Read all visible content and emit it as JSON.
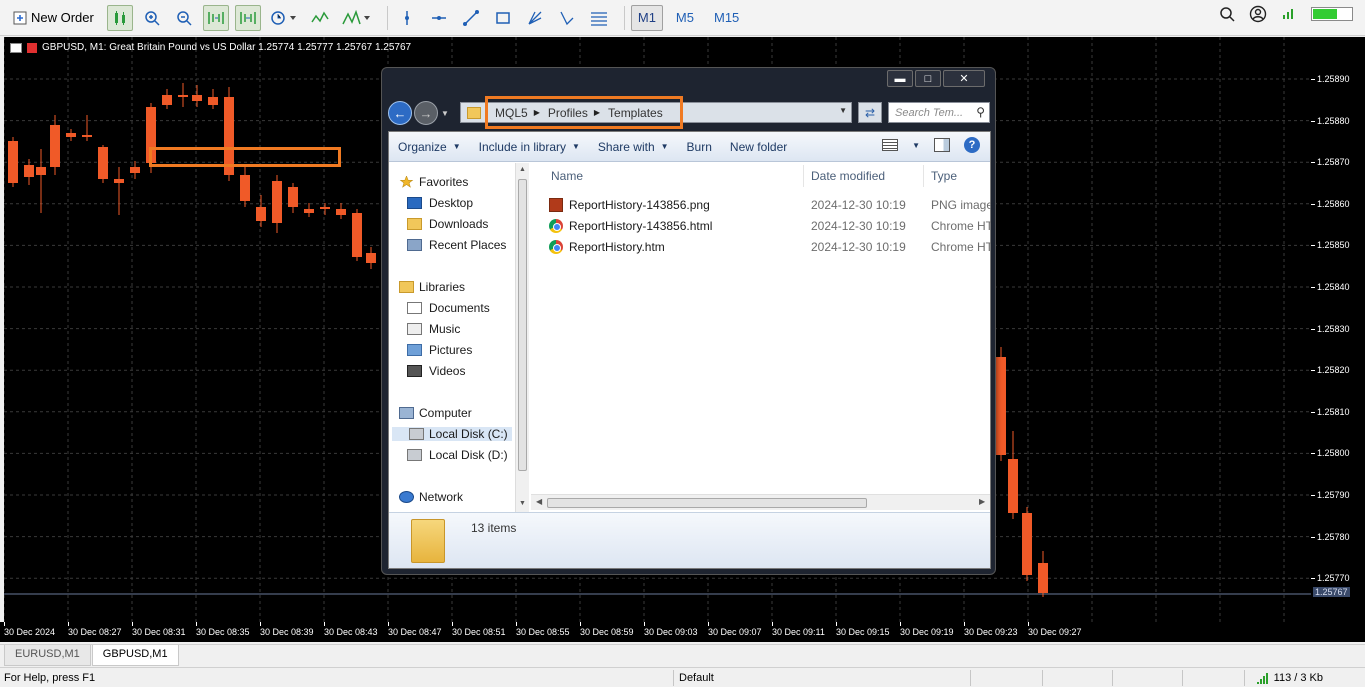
{
  "toolbar": {
    "new_order_label": "New Order",
    "timeframes": [
      "M1",
      "M5",
      "M15"
    ],
    "active_timeframe": "M1"
  },
  "chart": {
    "title": "GBPUSD, M1:  Great Britain Pound vs US Dollar  1.25774 1.25777 1.25767 1.25767",
    "current_price": "1.25767",
    "price_ticks": [
      "1.25890",
      "1.25880",
      "1.25870",
      "1.25860",
      "1.25850",
      "1.25840",
      "1.25830",
      "1.25820",
      "1.25810",
      "1.25800",
      "1.25790",
      "1.25780",
      "1.25770"
    ],
    "time_ticks": [
      "30 Dec 2024",
      "30 Dec 08:27",
      "30 Dec 08:31",
      "30 Dec 08:35",
      "30 Dec 08:39",
      "30 Dec 08:43",
      "30 Dec 08:47",
      "30 Dec 08:51",
      "30 Dec 08:55",
      "30 Dec 08:59",
      "30 Dec 09:03",
      "30 Dec 09:07",
      "30 Dec 09:11",
      "30 Dec 09:15",
      "30 Dec 09:19",
      "30 Dec 09:23",
      "30 Dec 09:27"
    ],
    "colors": {
      "bull": "#1fa03c",
      "bear": "#f05a28",
      "background": "#000000",
      "grid": "#3a3a3a"
    }
  },
  "explorer": {
    "address": [
      "MQL5",
      "Profiles",
      "Templates"
    ],
    "search_placeholder": "Search Tem...",
    "commands": [
      "Organize",
      "Include in library",
      "Share with",
      "Burn",
      "New folder"
    ],
    "nav": {
      "favorites": "Favorites",
      "favorites_items": [
        "Desktop",
        "Downloads",
        "Recent Places"
      ],
      "libraries": "Libraries",
      "libraries_items": [
        "Documents",
        "Music",
        "Pictures",
        "Videos"
      ],
      "computer": "Computer",
      "computer_items": [
        "Local Disk (C:)",
        "Local Disk (D:)"
      ],
      "network": "Network"
    },
    "columns": [
      "Name",
      "Date modified",
      "Type"
    ],
    "files": [
      {
        "name": "ReportHistory-143856.png",
        "date": "2024-12-30 10:19",
        "type": "PNG image",
        "icon": "png-file-icon"
      },
      {
        "name": "ReportHistory-143856.html",
        "date": "2024-12-30 10:19",
        "type": "Chrome HTML",
        "icon": "chrome-html-icon"
      },
      {
        "name": "ReportHistory.htm",
        "date": "2024-12-30 10:19",
        "type": "Chrome HTML",
        "icon": "chrome-html-icon"
      }
    ],
    "item_count": "13 items"
  },
  "tabs": [
    "EURUSD,M1",
    "GBPUSD,M1"
  ],
  "active_tab": "GBPUSD,M1",
  "status": {
    "help": "For Help, press F1",
    "profile": "Default",
    "traffic": "113 / 3 Kb"
  }
}
